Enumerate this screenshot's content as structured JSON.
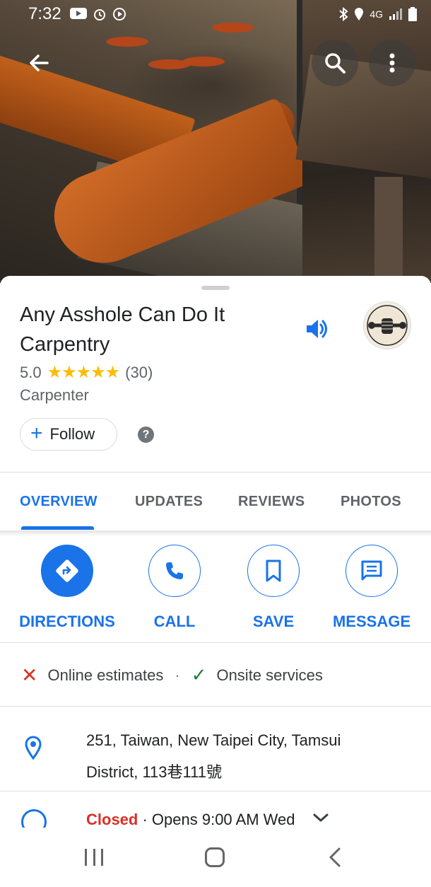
{
  "status_bar": {
    "time": "7:32",
    "network": "4G"
  },
  "header": {
    "back_icon": "arrow-left-icon",
    "search_icon": "search-icon",
    "more_icon": "more-vert-icon"
  },
  "place": {
    "name": "Any Asshole Can Do It Carpentry",
    "rating": "5.0",
    "stars": "★★★★★",
    "review_count": "(30)",
    "category": "Carpenter",
    "follow_label": "Follow",
    "help_glyph": "?"
  },
  "tabs": [
    {
      "label": "OVERVIEW",
      "active": true
    },
    {
      "label": "UPDATES",
      "active": false
    },
    {
      "label": "REVIEWS",
      "active": false
    },
    {
      "label": "PHOTOS",
      "active": false
    }
  ],
  "actions": [
    {
      "label": "DIRECTIONS",
      "icon": "directions-icon"
    },
    {
      "label": "CALL",
      "icon": "phone-icon"
    },
    {
      "label": "SAVE",
      "icon": "bookmark-icon"
    },
    {
      "label": "MESSAGE",
      "icon": "message-icon"
    }
  ],
  "services": {
    "online_estimates": "Online estimates",
    "separator": "·",
    "onsite_services": "Onsite services"
  },
  "address": {
    "line1": "251, Taiwan, New Taipei City, Tamsui",
    "line2": "District, 113巷111號"
  },
  "hours": {
    "status": "Closed",
    "separator": " · ",
    "detail": "Opens 9:00 AM Wed"
  },
  "colors": {
    "accent": "#1a73e8",
    "closed": "#d93025",
    "star": "#fbbc04",
    "check": "#188038"
  }
}
